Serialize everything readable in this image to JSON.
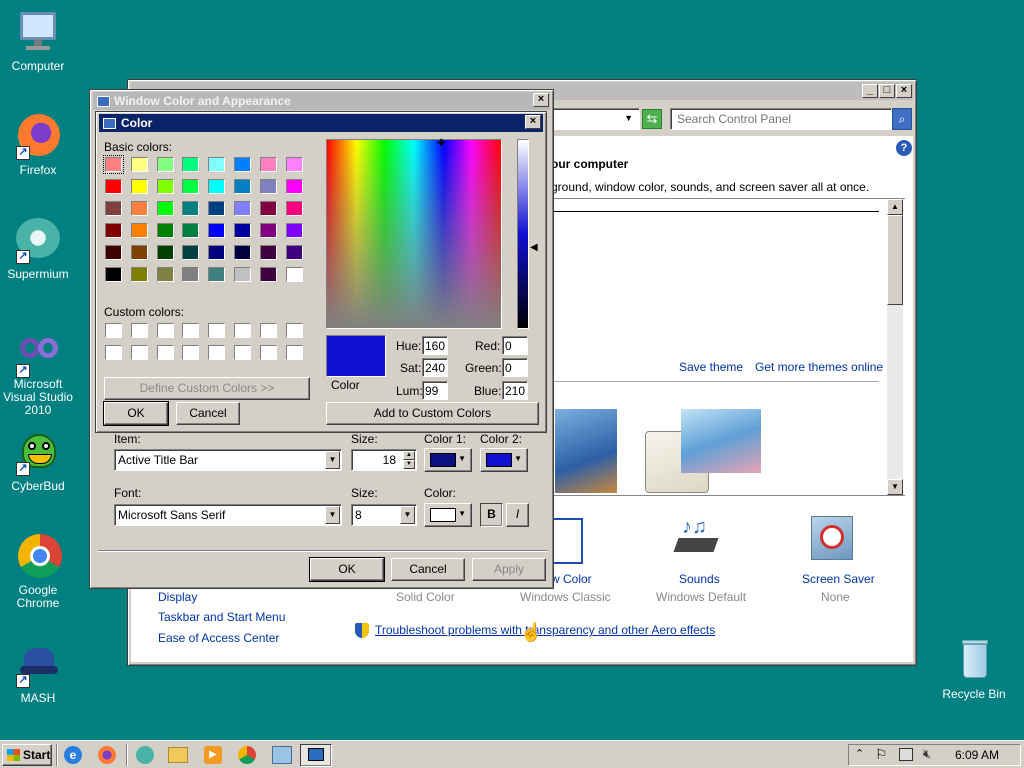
{
  "desktop": {
    "icons": [
      {
        "label": "Computer",
        "icon": "computer-icon"
      },
      {
        "label": "Firefox",
        "icon": "firefox-icon"
      },
      {
        "label": "Supermium",
        "icon": "supermium-icon"
      },
      {
        "label": "Microsoft Visual Studio 2010",
        "icon": "visual-studio-icon"
      },
      {
        "label": "CyberBud",
        "icon": "cyberbud-icon"
      },
      {
        "label": "Google Chrome",
        "icon": "chrome-icon"
      },
      {
        "label": "MASH",
        "icon": "mash-icon"
      },
      {
        "label": "Recycle Bin",
        "icon": "recycle-bin-icon"
      }
    ]
  },
  "personalization": {
    "search_placeholder": "Search Control Panel",
    "heading": "our computer",
    "subtitle": "ground, window color, sounds, and screen saver all at once.",
    "save_theme": "Save theme",
    "get_more_themes": "Get more themes online",
    "sidebar_links": [
      "Display",
      "Taskbar and Start Menu",
      "Ease of Access Center"
    ],
    "items": [
      {
        "title": "w Color",
        "sub": "Solid Color"
      },
      {
        "title": "",
        "sub": "Windows Classic"
      },
      {
        "title": "Sounds",
        "sub": "Windows Default"
      },
      {
        "title": "Screen Saver",
        "sub": "None"
      }
    ],
    "troubleshoot": "Troubleshoot problems with transparency and other Aero effects"
  },
  "appearance": {
    "title": "Window Color and Appearance",
    "item_label": "Item:",
    "item_value": "Active Title Bar",
    "size_label": "Size:",
    "size_value": "18",
    "color1_label": "Color 1:",
    "color2_label": "Color 2:",
    "color1": "#0a1080",
    "color2": "#1010d0",
    "font_label": "Font:",
    "font_value": "Microsoft Sans Serif",
    "font_size_label": "Size:",
    "font_size_value": "8",
    "font_color_label": "Color:",
    "bold": "B",
    "italic": "I",
    "ok": "OK",
    "cancel": "Cancel",
    "apply": "Apply"
  },
  "color_dialog": {
    "title": "Color",
    "basic_colors_label": "Basic colors:",
    "custom_colors_label": "Custom colors:",
    "define_custom": "Define Custom Colors >>",
    "ok": "OK",
    "cancel": "Cancel",
    "add_custom": "Add to Custom Colors",
    "color_label": "Color",
    "selected_color": "#1010d2",
    "hue_label": "Hue:",
    "hue": "160",
    "sat_label": "Sat:",
    "sat": "240",
    "lum_label": "Lum:",
    "lum": "99",
    "red_label": "Red:",
    "red": "0",
    "green_label": "Green:",
    "green": "0",
    "blue_label": "Blue:",
    "blue": "210",
    "basic_colors": [
      "#ff8080",
      "#ffff80",
      "#80ff80",
      "#00ff80",
      "#80ffff",
      "#0080ff",
      "#ff80c0",
      "#ff80ff",
      "#ff0000",
      "#ffff00",
      "#80ff00",
      "#00ff40",
      "#00ffff",
      "#0080c0",
      "#8080c0",
      "#ff00ff",
      "#804040",
      "#ff8040",
      "#00ff00",
      "#008080",
      "#004080",
      "#8080ff",
      "#800040",
      "#ff0080",
      "#800000",
      "#ff8000",
      "#008000",
      "#008040",
      "#0000ff",
      "#0000a0",
      "#800080",
      "#8000ff",
      "#400000",
      "#804000",
      "#004000",
      "#004040",
      "#000080",
      "#000040",
      "#400040",
      "#400080",
      "#000000",
      "#808000",
      "#808040",
      "#808080",
      "#408080",
      "#c0c0c0",
      "#400040",
      "#ffffff"
    ]
  },
  "taskbar": {
    "start": "Start",
    "clock": "6:09 AM"
  }
}
